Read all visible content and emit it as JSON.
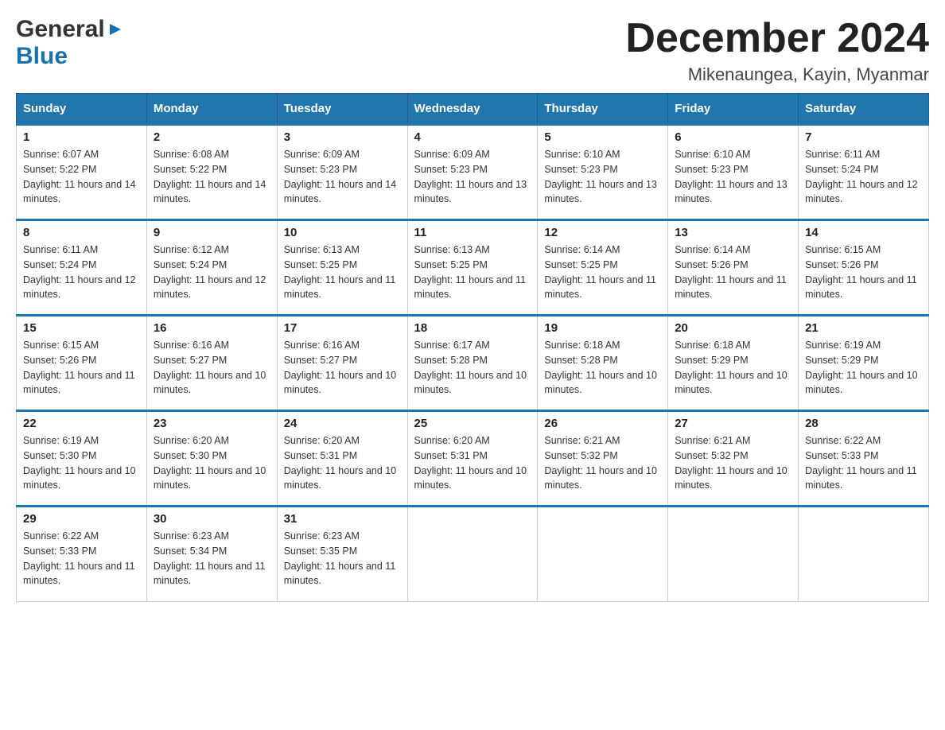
{
  "logo": {
    "general": "General",
    "blue": "Blue",
    "triangle": "▲"
  },
  "title": {
    "month": "December 2024",
    "location": "Mikenaungea, Kayin, Myanmar"
  },
  "weekdays": [
    "Sunday",
    "Monday",
    "Tuesday",
    "Wednesday",
    "Thursday",
    "Friday",
    "Saturday"
  ],
  "weeks": [
    [
      {
        "day": "1",
        "sunrise": "6:07 AM",
        "sunset": "5:22 PM",
        "daylight": "11 hours and 14 minutes."
      },
      {
        "day": "2",
        "sunrise": "6:08 AM",
        "sunset": "5:22 PM",
        "daylight": "11 hours and 14 minutes."
      },
      {
        "day": "3",
        "sunrise": "6:09 AM",
        "sunset": "5:23 PM",
        "daylight": "11 hours and 14 minutes."
      },
      {
        "day": "4",
        "sunrise": "6:09 AM",
        "sunset": "5:23 PM",
        "daylight": "11 hours and 13 minutes."
      },
      {
        "day": "5",
        "sunrise": "6:10 AM",
        "sunset": "5:23 PM",
        "daylight": "11 hours and 13 minutes."
      },
      {
        "day": "6",
        "sunrise": "6:10 AM",
        "sunset": "5:23 PM",
        "daylight": "11 hours and 13 minutes."
      },
      {
        "day": "7",
        "sunrise": "6:11 AM",
        "sunset": "5:24 PM",
        "daylight": "11 hours and 12 minutes."
      }
    ],
    [
      {
        "day": "8",
        "sunrise": "6:11 AM",
        "sunset": "5:24 PM",
        "daylight": "11 hours and 12 minutes."
      },
      {
        "day": "9",
        "sunrise": "6:12 AM",
        "sunset": "5:24 PM",
        "daylight": "11 hours and 12 minutes."
      },
      {
        "day": "10",
        "sunrise": "6:13 AM",
        "sunset": "5:25 PM",
        "daylight": "11 hours and 11 minutes."
      },
      {
        "day": "11",
        "sunrise": "6:13 AM",
        "sunset": "5:25 PM",
        "daylight": "11 hours and 11 minutes."
      },
      {
        "day": "12",
        "sunrise": "6:14 AM",
        "sunset": "5:25 PM",
        "daylight": "11 hours and 11 minutes."
      },
      {
        "day": "13",
        "sunrise": "6:14 AM",
        "sunset": "5:26 PM",
        "daylight": "11 hours and 11 minutes."
      },
      {
        "day": "14",
        "sunrise": "6:15 AM",
        "sunset": "5:26 PM",
        "daylight": "11 hours and 11 minutes."
      }
    ],
    [
      {
        "day": "15",
        "sunrise": "6:15 AM",
        "sunset": "5:26 PM",
        "daylight": "11 hours and 11 minutes."
      },
      {
        "day": "16",
        "sunrise": "6:16 AM",
        "sunset": "5:27 PM",
        "daylight": "11 hours and 10 minutes."
      },
      {
        "day": "17",
        "sunrise": "6:16 AM",
        "sunset": "5:27 PM",
        "daylight": "11 hours and 10 minutes."
      },
      {
        "day": "18",
        "sunrise": "6:17 AM",
        "sunset": "5:28 PM",
        "daylight": "11 hours and 10 minutes."
      },
      {
        "day": "19",
        "sunrise": "6:18 AM",
        "sunset": "5:28 PM",
        "daylight": "11 hours and 10 minutes."
      },
      {
        "day": "20",
        "sunrise": "6:18 AM",
        "sunset": "5:29 PM",
        "daylight": "11 hours and 10 minutes."
      },
      {
        "day": "21",
        "sunrise": "6:19 AM",
        "sunset": "5:29 PM",
        "daylight": "11 hours and 10 minutes."
      }
    ],
    [
      {
        "day": "22",
        "sunrise": "6:19 AM",
        "sunset": "5:30 PM",
        "daylight": "11 hours and 10 minutes."
      },
      {
        "day": "23",
        "sunrise": "6:20 AM",
        "sunset": "5:30 PM",
        "daylight": "11 hours and 10 minutes."
      },
      {
        "day": "24",
        "sunrise": "6:20 AM",
        "sunset": "5:31 PM",
        "daylight": "11 hours and 10 minutes."
      },
      {
        "day": "25",
        "sunrise": "6:20 AM",
        "sunset": "5:31 PM",
        "daylight": "11 hours and 10 minutes."
      },
      {
        "day": "26",
        "sunrise": "6:21 AM",
        "sunset": "5:32 PM",
        "daylight": "11 hours and 10 minutes."
      },
      {
        "day": "27",
        "sunrise": "6:21 AM",
        "sunset": "5:32 PM",
        "daylight": "11 hours and 10 minutes."
      },
      {
        "day": "28",
        "sunrise": "6:22 AM",
        "sunset": "5:33 PM",
        "daylight": "11 hours and 11 minutes."
      }
    ],
    [
      {
        "day": "29",
        "sunrise": "6:22 AM",
        "sunset": "5:33 PM",
        "daylight": "11 hours and 11 minutes."
      },
      {
        "day": "30",
        "sunrise": "6:23 AM",
        "sunset": "5:34 PM",
        "daylight": "11 hours and 11 minutes."
      },
      {
        "day": "31",
        "sunrise": "6:23 AM",
        "sunset": "5:35 PM",
        "daylight": "11 hours and 11 minutes."
      },
      null,
      null,
      null,
      null
    ]
  ]
}
